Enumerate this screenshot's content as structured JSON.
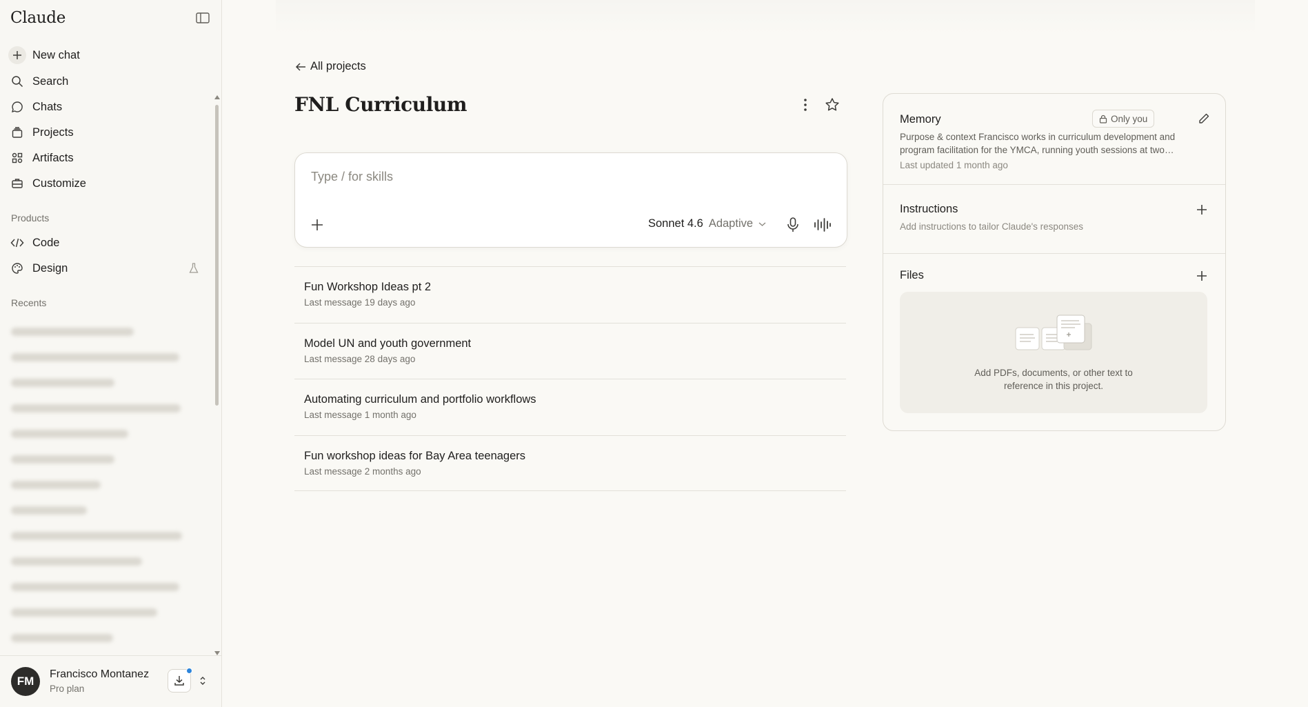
{
  "sidebar": {
    "logo": "Claude",
    "nav": [
      {
        "label": "New chat",
        "icon": "plus-icon"
      },
      {
        "label": "Search",
        "icon": "search-icon"
      },
      {
        "label": "Chats",
        "icon": "chat-bubble-icon"
      },
      {
        "label": "Projects",
        "icon": "projects-icon"
      },
      {
        "label": "Artifacts",
        "icon": "artifacts-icon"
      },
      {
        "label": "Customize",
        "icon": "briefcase-icon"
      }
    ],
    "products_title": "Products",
    "products": [
      {
        "label": "Code",
        "icon": "code-icon"
      },
      {
        "label": "Design",
        "icon": "palette-icon",
        "badge_icon": "flask-icon"
      }
    ],
    "recents_title": "Recents",
    "user": {
      "initials": "FM",
      "name": "Francisco Montanez",
      "plan": "Pro plan"
    }
  },
  "main": {
    "back_label": "All projects",
    "title": "FNL Curriculum",
    "composer": {
      "placeholder": "Type / for skills",
      "model": "Sonnet 4.6",
      "mode": "Adaptive"
    },
    "chats": [
      {
        "title": "Fun Workshop Ideas pt 2",
        "meta": "Last message 19 days ago"
      },
      {
        "title": "Model UN and youth government",
        "meta": "Last message 28 days ago"
      },
      {
        "title": "Automating curriculum and portfolio workflows",
        "meta": "Last message 1 month ago"
      },
      {
        "title": "Fun workshop ideas for Bay Area teenagers",
        "meta": "Last message 2 months ago"
      }
    ]
  },
  "panel": {
    "memory": {
      "title": "Memory",
      "visibility": "Only you",
      "text": "Purpose & context Francisco works in curriculum development and program facilitation for the YMCA, running youth sessions at two…",
      "updated": "Last updated 1 month ago"
    },
    "instructions": {
      "title": "Instructions",
      "subtitle": "Add instructions to tailor Claude's responses"
    },
    "files": {
      "title": "Files",
      "empty_line1": "Add PDFs, documents, or other text to",
      "empty_line2": "reference in this project."
    }
  },
  "colors": {
    "background": "#faf9f5",
    "sidebar": "#f8f7f3",
    "text": "#1f1e1d",
    "muted": "#73716b",
    "notification_dot": "#2c84db"
  }
}
